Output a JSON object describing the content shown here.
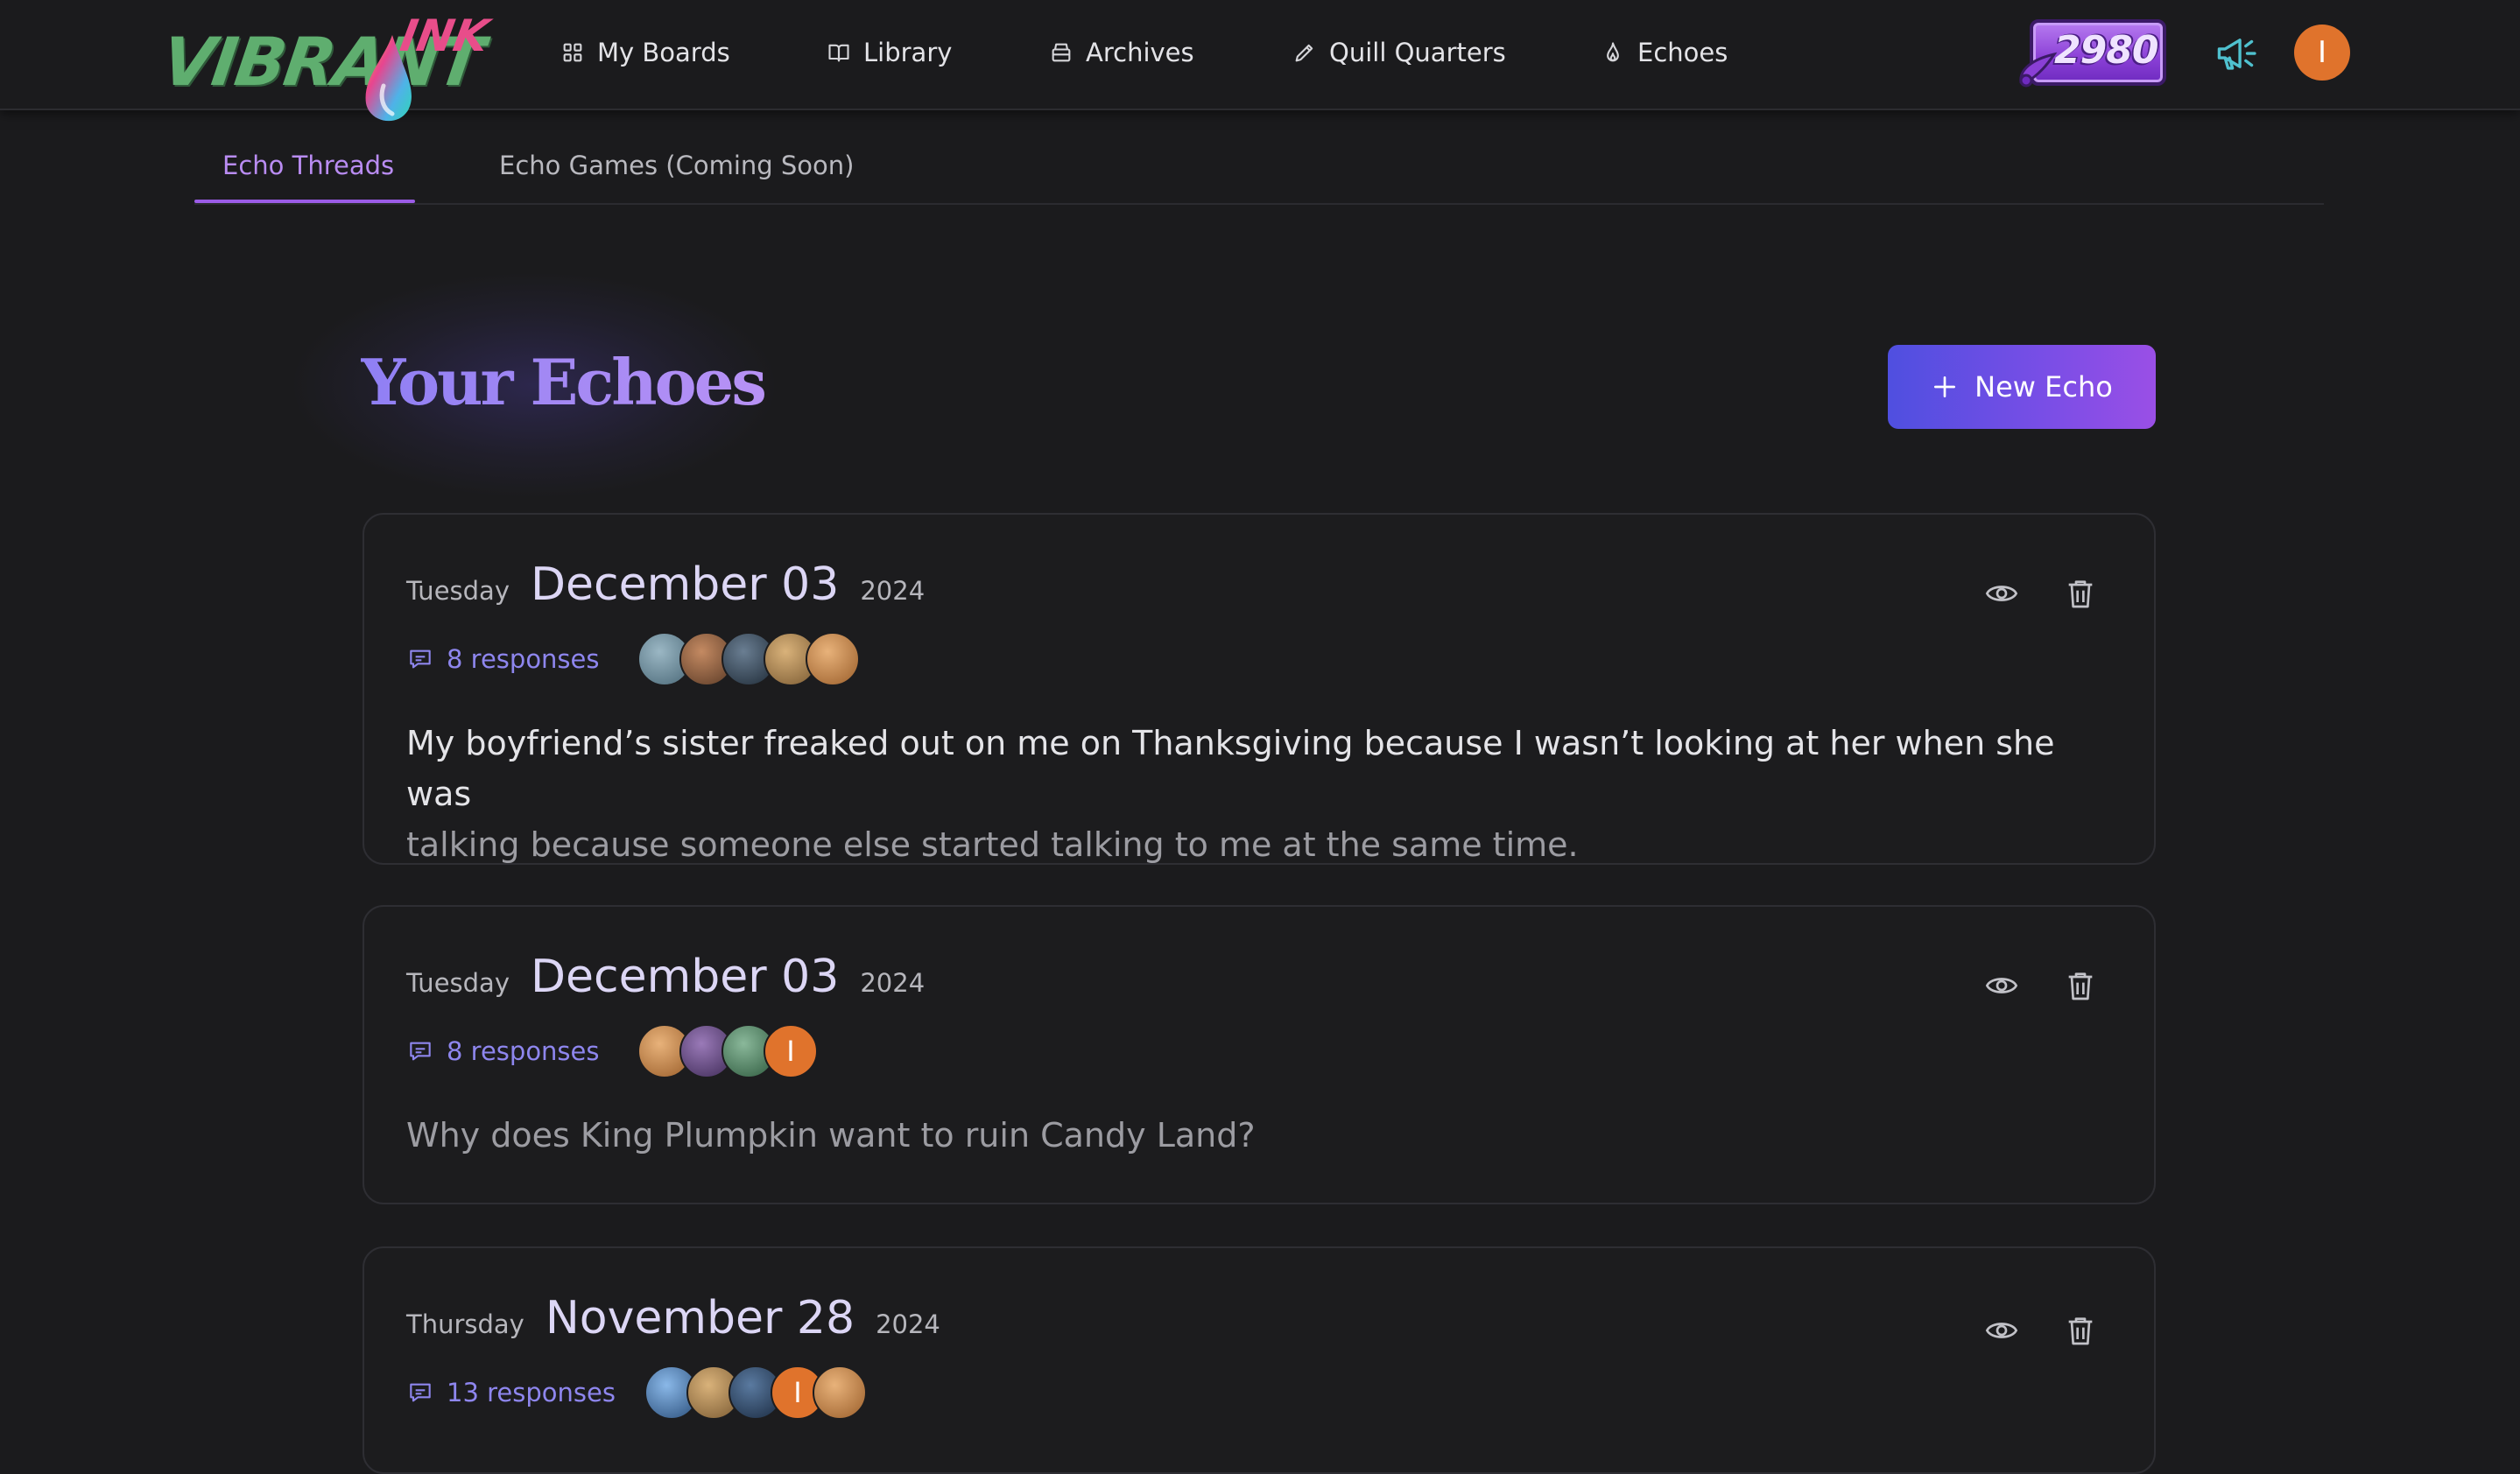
{
  "brand": {
    "word": "VIBRANT",
    "ink": "INK"
  },
  "nav": {
    "items": [
      {
        "label": "My Boards",
        "icon": "grid-icon"
      },
      {
        "label": "Library",
        "icon": "book-icon"
      },
      {
        "label": "Archives",
        "icon": "archive-icon"
      },
      {
        "label": "Quill Quarters",
        "icon": "pencil-icon"
      },
      {
        "label": "Echoes",
        "icon": "flame-icon"
      }
    ],
    "points": "2980",
    "user_initial": "I"
  },
  "subtabs": {
    "active": "Echo Threads",
    "inactive": "Echo Games (Coming Soon)"
  },
  "main": {
    "title": "Your Echoes",
    "new_echo_label": "New Echo"
  },
  "echoes": [
    {
      "weekday": "Tuesday",
      "monthday": "December 03",
      "year": "2024",
      "responses": "8 responses",
      "avatars": [
        {
          "color": "#5f7f8e"
        },
        {
          "color": "#8a5a3e"
        },
        {
          "color": "#3a4a5a"
        },
        {
          "color": "#b9884f"
        },
        {
          "color": "#c48a4a"
        }
      ],
      "text_line1": "My boyfriend’s sister freaked out on me on Thanksgiving because I wasn’t looking at her when she was",
      "text_line2": "talking because someone else started talking to me at the same time."
    },
    {
      "weekday": "Tuesday",
      "monthday": "December 03",
      "year": "2024",
      "responses": "8 responses",
      "avatars": [
        {
          "color": "#c48a4a"
        },
        {
          "color": "#6b4f8a"
        },
        {
          "color": "#5c8a6a"
        },
        {
          "color": "#e0732c",
          "initial": "I"
        }
      ],
      "text_line1": "",
      "text_line2": "Why does King Plumpkin want to ruin Candy Land?"
    },
    {
      "weekday": "Thursday",
      "monthday": "November 28",
      "year": "2024",
      "responses": "13 responses",
      "avatars": [
        {
          "color": "#4f7fb8"
        },
        {
          "color": "#b9884f"
        },
        {
          "color": "#2f4a6a"
        },
        {
          "color": "#e0732c",
          "initial": "I"
        },
        {
          "color": "#c48a4a"
        }
      ],
      "text_line1": "",
      "text_line2": ""
    }
  ],
  "colors": {
    "accent": "#9b5ce6",
    "title_gradient_start": "#8f7ff4",
    "title_gradient_end": "#b892f5",
    "button_start": "#4f4fe0",
    "button_end": "#9a4fe6",
    "response_link": "#8e86ee",
    "user_avatar": "#e0732c"
  }
}
